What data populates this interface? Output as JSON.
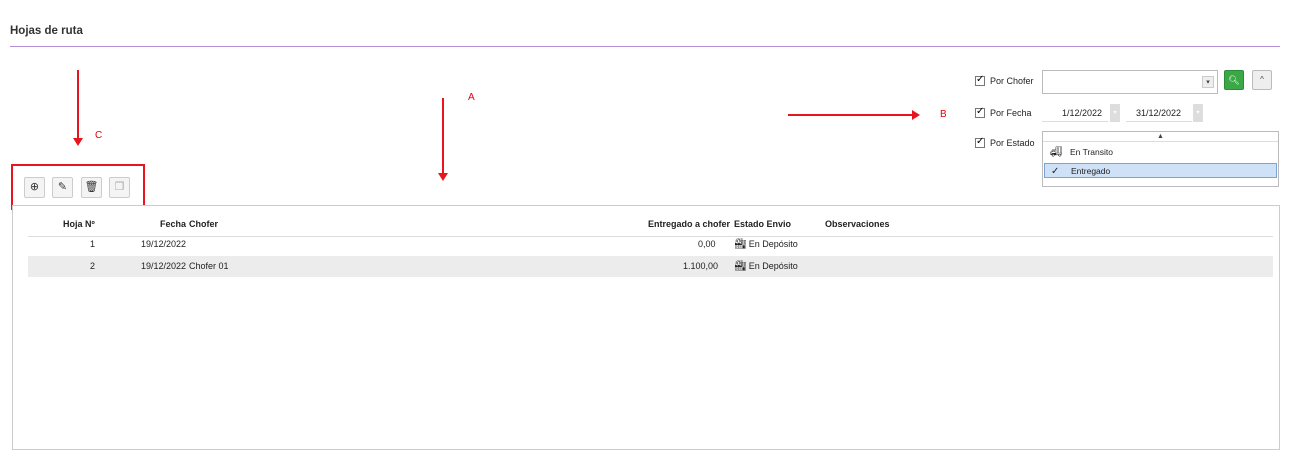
{
  "page": {
    "title": "Hojas de ruta",
    "accent_color": "#b48fd6"
  },
  "filters": {
    "chofer": {
      "label": "Por Chofer",
      "checked": true,
      "value": "",
      "search_icon": "search-icon",
      "collapse_icon": "chevron-up-icon"
    },
    "fecha": {
      "label": "Por Fecha",
      "checked": true,
      "from": "1/12/2022",
      "to": "31/12/2022"
    },
    "estado": {
      "label": "Por Estado",
      "checked": true,
      "options": [
        {
          "label": "En Transito",
          "icon": "truck-icon",
          "selected": false
        },
        {
          "label": "Entregado",
          "icon": "check-icon",
          "selected": true
        }
      ]
    }
  },
  "annotations": {
    "a": "A",
    "b": "B",
    "c": "C",
    "color": "#e8141e"
  },
  "toolbar": {
    "add_icon": "add-circle-icon",
    "edit_icon": "pencil-icon",
    "delete_icon": "trash-icon",
    "copy_icon": "copy-icon"
  },
  "grid": {
    "columns": [
      "Hoja Nº",
      "Fecha",
      "Chofer",
      "Entregado a chofer",
      "Estado Envio",
      "Observaciones"
    ],
    "rows": [
      {
        "hoja": "1",
        "fecha": "19/12/2022",
        "chofer": "",
        "entregado": "0,00",
        "estado": "En Depósito",
        "observaciones": ""
      },
      {
        "hoja": "2",
        "fecha": "19/12/2022",
        "chofer": "Chofer 01",
        "entregado": "1.100,00",
        "estado": "En Depósito",
        "observaciones": ""
      }
    ]
  }
}
